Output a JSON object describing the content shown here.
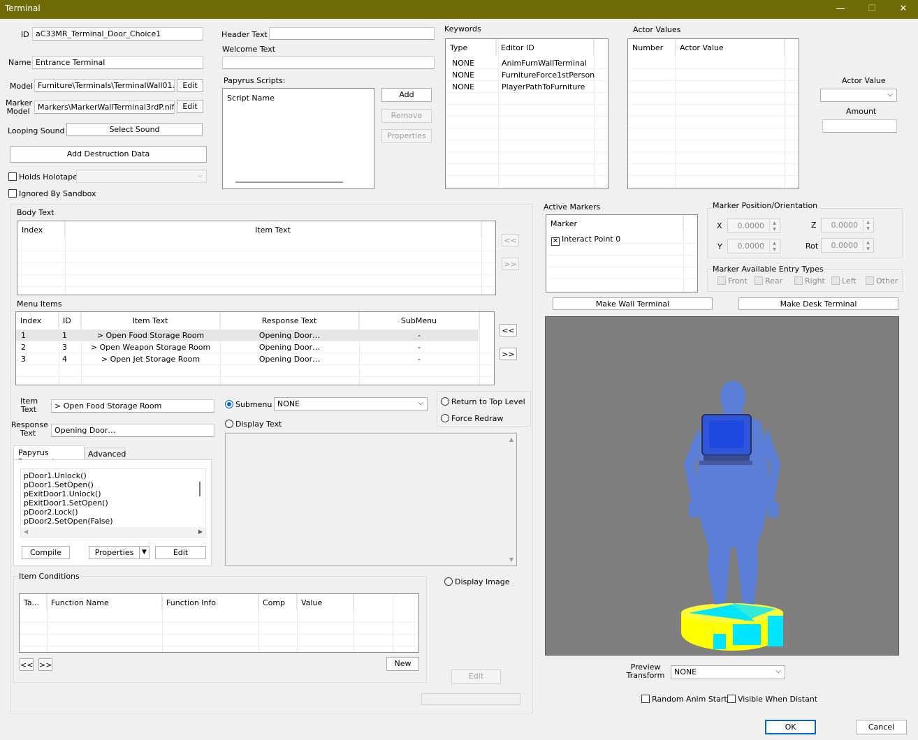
{
  "window": {
    "title": "Terminal",
    "minimize": "—",
    "maximize": "☐",
    "close": "✕"
  },
  "basic": {
    "id_label": "ID",
    "id_value": "aC33MR_Terminal_Door_Choice1",
    "name_label": "Name",
    "name_value": "Entrance Terminal",
    "model_label": "Model",
    "model_value": "Furniture\\Terminals\\TerminalWall01.nif",
    "edit": "Edit",
    "marker_model_label": "Marker Model",
    "marker_model_value": "Markers\\MarkerWallTerminal3rdP.nif",
    "looping_sound_label": "Looping Sound",
    "select_sound": "Select Sound",
    "add_destruction": "Add Destruction Data",
    "holds_holotape": "Holds Holotape",
    "ignored_by_sandbox": "Ignored By Sandbox"
  },
  "header": {
    "header_text_label": "Header Text",
    "header_text_value": "",
    "welcome_text_label": "Welcome Text",
    "welcome_text_value": ""
  },
  "papyrus": {
    "label": "Papyrus Scripts:",
    "column": "Script Name",
    "add": "Add",
    "remove": "Remove",
    "properties": "Properties"
  },
  "keywords": {
    "label": "Keywords",
    "columns": [
      "Type",
      "Editor ID"
    ],
    "rows": [
      [
        "NONE",
        "AnimFurnWallTerminal"
      ],
      [
        "NONE",
        "FurnitureForce1stPerson"
      ],
      [
        "NONE",
        "PlayerPathToFurniture"
      ]
    ]
  },
  "actor_values": {
    "label": "Actor Values",
    "columns": [
      "Number",
      "Actor Value"
    ],
    "actor_value_label": "Actor Value",
    "amount_label": "Amount"
  },
  "body_text": {
    "label": "Body Text",
    "columns": [
      "Index",
      "Item Text"
    ],
    "up": "<<",
    "down": ">>"
  },
  "menu_items": {
    "label": "Menu Items",
    "columns": [
      "Index",
      "ID",
      "Item Text",
      "Response Text",
      "SubMenu"
    ],
    "rows": [
      [
        "1",
        "1",
        "> Open Food Storage Room",
        "Opening Door…",
        "-"
      ],
      [
        "2",
        "3",
        "> Open Weapon Storage Room",
        "Opening Door…",
        "-"
      ],
      [
        "3",
        "4",
        "> Open Jet Storage Room",
        "Opening Door…",
        "-"
      ]
    ],
    "up": "<<",
    "down": ">>"
  },
  "item": {
    "item_text_label": "Item Text",
    "item_text_value": "> Open Food Storage Room",
    "response_text_label": "Response Text",
    "response_text_value": "Opening Door…",
    "submenu": "Submenu",
    "submenu_value": "NONE",
    "display_text": "Display Text",
    "return_top": "Return to Top Level",
    "force_redraw": "Force Redraw",
    "display_image": "Display Image",
    "edit": "Edit"
  },
  "fragment": {
    "tab_papyrus": "Papyrus Fragment",
    "tab_advanced": "Advanced",
    "lines": [
      "pDoor1.Unlock()",
      "pDoor1.SetOpen()",
      "pExitDoor1.Unlock()",
      "pExitDoor1.SetOpen()",
      "pDoor2.Lock()",
      "pDoor2.SetOpen(False)"
    ],
    "compile": "Compile",
    "properties": "Properties",
    "edit": "Edit"
  },
  "conditions": {
    "label": "Item Conditions",
    "columns": [
      "Ta...",
      "Function Name",
      "Function Info",
      "Comp",
      "Value"
    ],
    "prev": "<<",
    "next": ">>",
    "new": "New"
  },
  "markers": {
    "active_label": "Active Markers",
    "column": "Marker",
    "interact": "Interact Point 0",
    "pos_label": "Marker Position/Orientation",
    "x_label": "X",
    "x": "0.0000",
    "y_label": "Y",
    "y": "0.0000",
    "z_label": "Z",
    "z": "0.0000",
    "rot_label": "Rot",
    "rot": "0.0000",
    "entry_label": "Marker Available Entry Types",
    "entries": [
      "Front",
      "Rear",
      "Right",
      "Left",
      "Other"
    ],
    "make_wall": "Make Wall Terminal",
    "make_desk": "Make Desk Terminal"
  },
  "preview": {
    "transform_label": "Preview Transform",
    "transform_value": "NONE",
    "random_anim": "Random Anim Start",
    "visible_distant": "Visible When Distant"
  },
  "footer": {
    "ok": "OK",
    "cancel": "Cancel"
  },
  "colors": {
    "titlebar": "#6f6b06",
    "preview_bg": "#7f7f7f",
    "figure": "#5b7fdd",
    "base_yellow": "#ffff00",
    "base_cyan": "#00e5ff"
  }
}
